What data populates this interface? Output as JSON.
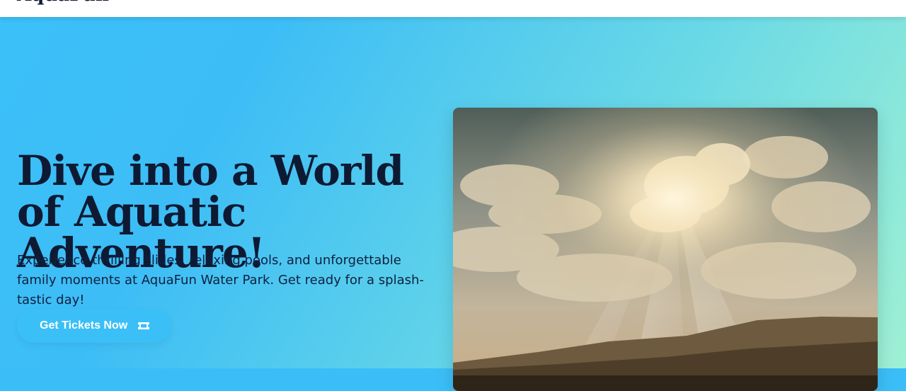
{
  "header": {
    "logo": "AquaFun"
  },
  "hero": {
    "headline": "Dive into a World of Aquatic Adventure!",
    "subtitle": "Experience thrilling slides, relaxing pools, and unforgettable family moments at AquaFun Water Park. Get ready for a splash-tastic day!",
    "cta_label": "Get Tickets Now",
    "cta_icon": "ticket-icon",
    "image_icon": "hero-photo"
  },
  "colors": {
    "heading": "#0e1a33",
    "button": "#3abff6",
    "gradient_start": "#3cc0f8",
    "gradient_end": "#9ff0d3"
  }
}
